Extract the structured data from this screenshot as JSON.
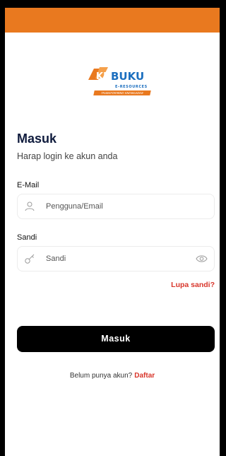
{
  "colors": {
    "topbar": "#e9791f",
    "accent_link": "#d8362b",
    "button": "#000000"
  },
  "logo": {
    "mark_text": "KI",
    "brand_text": "BUKU",
    "sub_text": "E-RESOURCES",
    "tagline": "TRANSFORMING KNOWLEDGE"
  },
  "header": {
    "title": "Masuk",
    "subtitle": "Harap login ke akun anda"
  },
  "form": {
    "email_label": "E-Mail",
    "email_placeholder": "Pengguna/Email",
    "email_icon": "user-icon",
    "password_label": "Sandi",
    "password_placeholder": "Sandi",
    "password_icon": "key-icon",
    "password_toggle_icon": "eye-icon",
    "forgot_label": "Lupa sandi?",
    "submit_label": "Masuk"
  },
  "footer": {
    "prompt": "Belum punya akun?",
    "signup_label": "Daftar"
  }
}
